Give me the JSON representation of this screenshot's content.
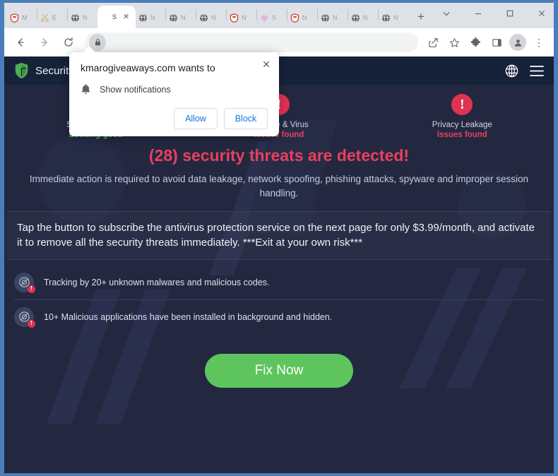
{
  "browser": {
    "tabs": [
      {
        "title": "M",
        "favicon": "shield-red-icon",
        "active": false
      },
      {
        "title": "E",
        "favicon": "scissors-icon",
        "active": false
      },
      {
        "title": "N",
        "favicon": "globe-icon",
        "active": false
      },
      {
        "title": "S",
        "favicon": "blank-icon",
        "active": true
      },
      {
        "title": "N",
        "favicon": "globe-icon",
        "active": false
      },
      {
        "title": "N",
        "favicon": "globe-icon",
        "active": false
      },
      {
        "title": "N",
        "favicon": "globe-icon",
        "active": false
      },
      {
        "title": "N",
        "favicon": "shield-red-icon",
        "active": false
      },
      {
        "title": "S",
        "favicon": "heart-icon",
        "active": false
      },
      {
        "title": "N",
        "favicon": "shield-red-icon",
        "active": false
      },
      {
        "title": "N",
        "favicon": "globe-icon",
        "active": false
      },
      {
        "title": "N",
        "favicon": "globe-icon",
        "active": false
      },
      {
        "title": "N",
        "favicon": "globe-icon",
        "active": false
      }
    ],
    "new_tab_label": "+",
    "window_controls": {
      "tab_search": "⌄",
      "minimize": "–",
      "maximize": "☐",
      "close": "✕"
    },
    "toolbar": {
      "back": "←",
      "forward": "→",
      "reload": "⟳",
      "url": "",
      "share": "share-icon",
      "bookmark": "star-icon",
      "extensions": "puzzle-icon",
      "side_panel": "panel-icon",
      "profile": "profile-icon",
      "menu": "⋮"
    }
  },
  "dialog": {
    "title": "kmarogiveaways.com wants to",
    "permission_label": "Show notifications",
    "allow_label": "Allow",
    "block_label": "Block",
    "close_label": "✕"
  },
  "page": {
    "header": {
      "brand": "Security P",
      "language_icon": "globe-icon",
      "menu_icon": "hamburger-icon"
    },
    "status_cards": [
      {
        "mark": "!",
        "label": "System Security",
        "state": "Looking good",
        "ok": true
      },
      {
        "mark": "!",
        "label": "Malware & Virus",
        "state": "Issues found",
        "ok": false
      },
      {
        "mark": "!",
        "label": "Privacy Leakage",
        "state": "Issues found",
        "ok": false
      }
    ],
    "headline": "(28) security threats are detected!",
    "subtext": "Immediate action is required to avoid data leakage, network spoofing, phishing attacks, spyware and improper session handling.",
    "offer_text": "Tap the button to subscribe the antivirus protection service on the next page for only $3.99/month, and activate it to remove all the security threats immediately. ***Exit at your own risk***",
    "threats": [
      {
        "text": "Tracking by 20+ unknown malwares and malicious codes.",
        "icon": "camera-alert-icon",
        "badge": "!"
      },
      {
        "text": "10+ Malicious applications have been installed in background and hidden.",
        "icon": "app-alert-icon",
        "badge": "!"
      }
    ],
    "cta_label": "Fix Now",
    "colors": {
      "page_bg": "#232840",
      "header_bg": "#16213a",
      "danger": "#e8405f",
      "good": "#3fbf66",
      "cta": "#5ec45e"
    }
  }
}
